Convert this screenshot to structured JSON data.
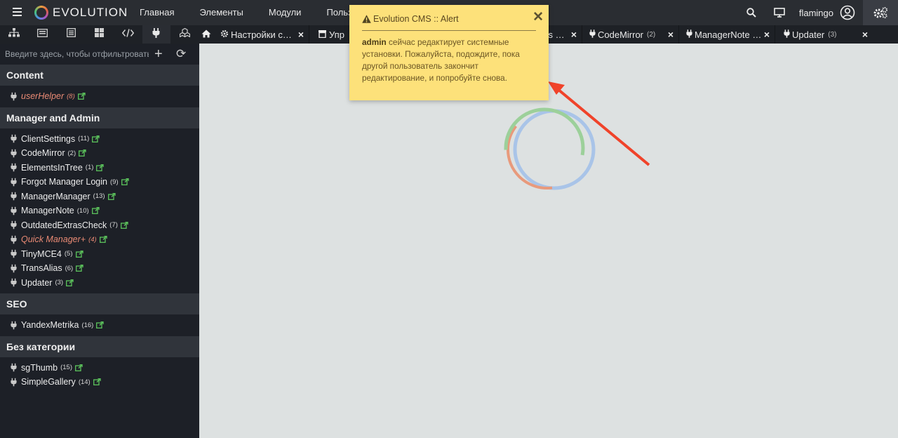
{
  "app": {
    "brand": "EVOLUTION"
  },
  "topnav": [
    "Главная",
    "Элементы",
    "Модули",
    "Пользова"
  ],
  "user": {
    "name": "flamingo"
  },
  "tree_tabs": [
    {
      "icon": "sitemap-icon"
    },
    {
      "icon": "templates-icon"
    },
    {
      "icon": "list-icon"
    },
    {
      "icon": "grid-icon"
    },
    {
      "icon": "code-icon"
    },
    {
      "icon": "plug-icon"
    },
    {
      "icon": "modules-icon"
    }
  ],
  "doc_tabs": [
    {
      "label": "Настройки с…",
      "icon": "gear-icon",
      "count": ""
    },
    {
      "label": "Упр",
      "icon": "doc-icon",
      "count": ""
    },
    {
      "label": "Settings …",
      "icon": "",
      "count": ""
    },
    {
      "label": "CodeMirror",
      "icon": "plug-icon",
      "count": "(2)"
    },
    {
      "label": "ManagerNote …",
      "icon": "plug-icon",
      "count": ""
    },
    {
      "label": "Updater",
      "icon": "plug-icon",
      "count": "(3)"
    }
  ],
  "filter": {
    "placeholder": "Введите здесь, чтобы отфильтровать"
  },
  "categories": [
    {
      "name": "Content",
      "items": [
        {
          "label": "userHelper",
          "count": "(8)",
          "disabled": true
        }
      ]
    },
    {
      "name": "Manager and Admin",
      "items": [
        {
          "label": "ClientSettings",
          "count": "(11)",
          "disabled": false
        },
        {
          "label": "CodeMirror",
          "count": "(2)",
          "disabled": false
        },
        {
          "label": "ElementsInTree",
          "count": "(1)",
          "disabled": false
        },
        {
          "label": "Forgot Manager Login",
          "count": "(9)",
          "disabled": false
        },
        {
          "label": "ManagerManager",
          "count": "(13)",
          "disabled": false
        },
        {
          "label": "ManagerNote",
          "count": "(10)",
          "disabled": false
        },
        {
          "label": "OutdatedExtrasCheck",
          "count": "(7)",
          "disabled": false
        },
        {
          "label": "Quick Manager+",
          "count": "(4)",
          "disabled": true
        },
        {
          "label": "TinyMCE4",
          "count": "(5)",
          "disabled": false
        },
        {
          "label": "TransAlias",
          "count": "(6)",
          "disabled": false
        },
        {
          "label": "Updater",
          "count": "(3)",
          "disabled": false
        }
      ]
    },
    {
      "name": "SEO",
      "items": [
        {
          "label": "YandexMetrika",
          "count": "(16)",
          "disabled": false
        }
      ]
    },
    {
      "name": "Без категории",
      "items": [
        {
          "label": "sgThumb",
          "count": "(15)",
          "disabled": false
        },
        {
          "label": "SimpleGallery",
          "count": "(14)",
          "disabled": false
        }
      ]
    }
  ],
  "alert": {
    "title": "Evolution CMS :: Alert",
    "user": "admin",
    "message": " сейчас редактирует системные установки. Пожалуйста, подождите, пока другой пользователь закончит редактирование, и попробуйте снова."
  },
  "colors": {
    "alert_bg": "#fde17a",
    "disabled_item": "#e98a74",
    "external_link": "#5cc35c",
    "arrow": "#f0432a"
  }
}
